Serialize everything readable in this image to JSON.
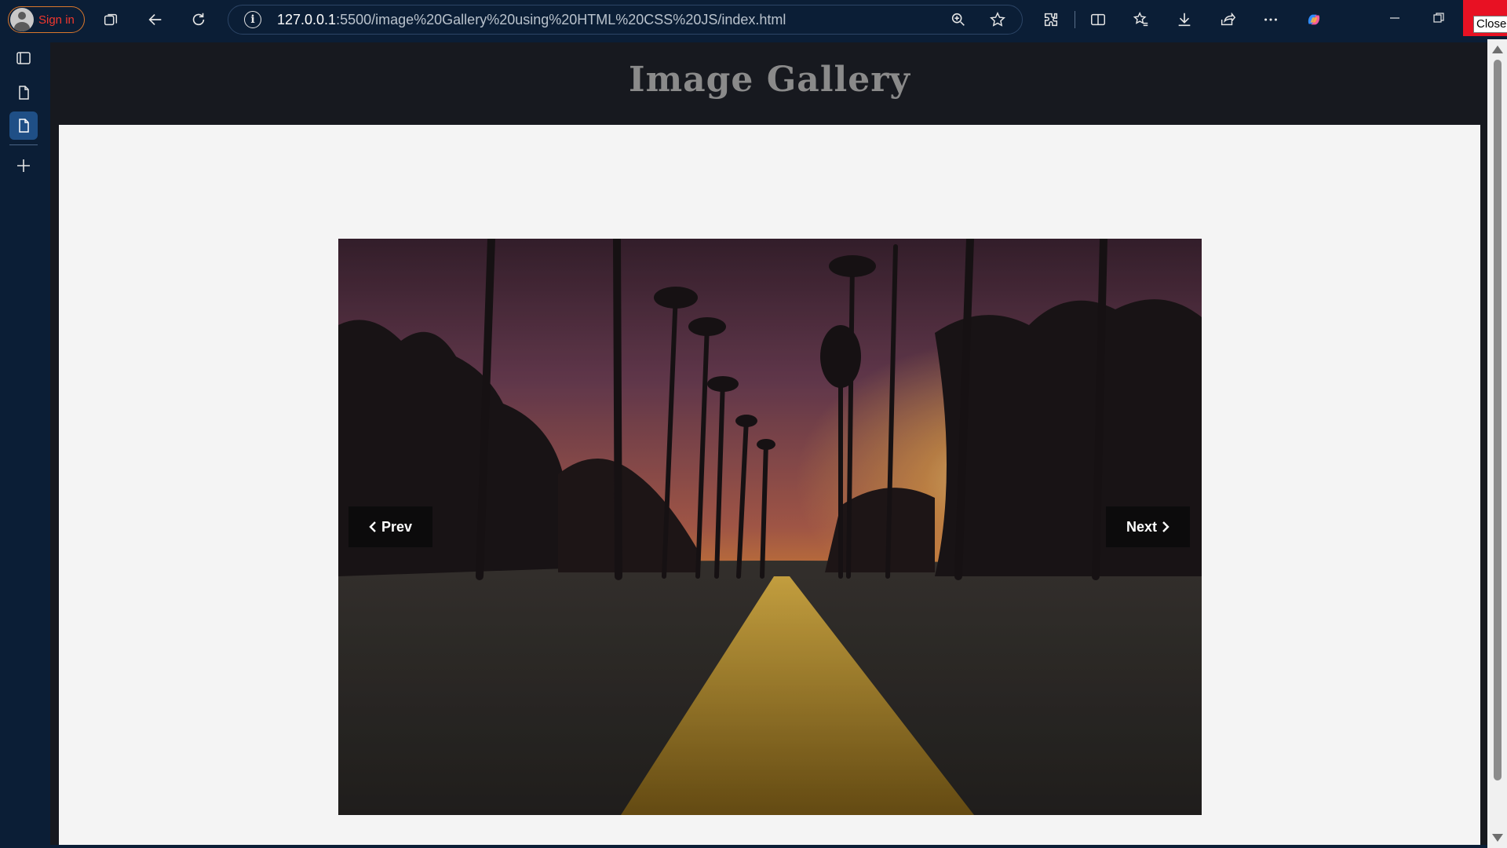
{
  "browser": {
    "signin_label": "Sign in",
    "url_host": "127.0.0.1",
    "url_path": ":5500/image%20Gallery%20using%20HTML%20CSS%20JS/index.html",
    "close_tooltip": "Close",
    "info_icon_glyph": "i",
    "toolbar_icons": [
      "workspaces-icon",
      "back-arrow-icon",
      "refresh-icon",
      "extensions-icon",
      "split-screen-icon",
      "favorites-icon",
      "download-icon",
      "share-icon",
      "more-icon",
      "copilot-icon"
    ],
    "sidebar_icons": [
      "tab-actions-icon",
      "page-tab-icon",
      "active-page-tab-icon",
      "new-tab-plus-icon"
    ],
    "accent_color": "#1f4f86",
    "close_color": "#e81123"
  },
  "page": {
    "title": "Image Gallery",
    "prev_label": "Prev",
    "next_label": "Next",
    "prev_icon": "chevron-left-icon",
    "next_icon": "chevron-right-icon",
    "title_color": "#8a8a8a",
    "header_bg": "#17191f",
    "content_bg": "#f4f4f4"
  },
  "gallery": {
    "image_description_icon": "sunset-road-palms-photo"
  }
}
